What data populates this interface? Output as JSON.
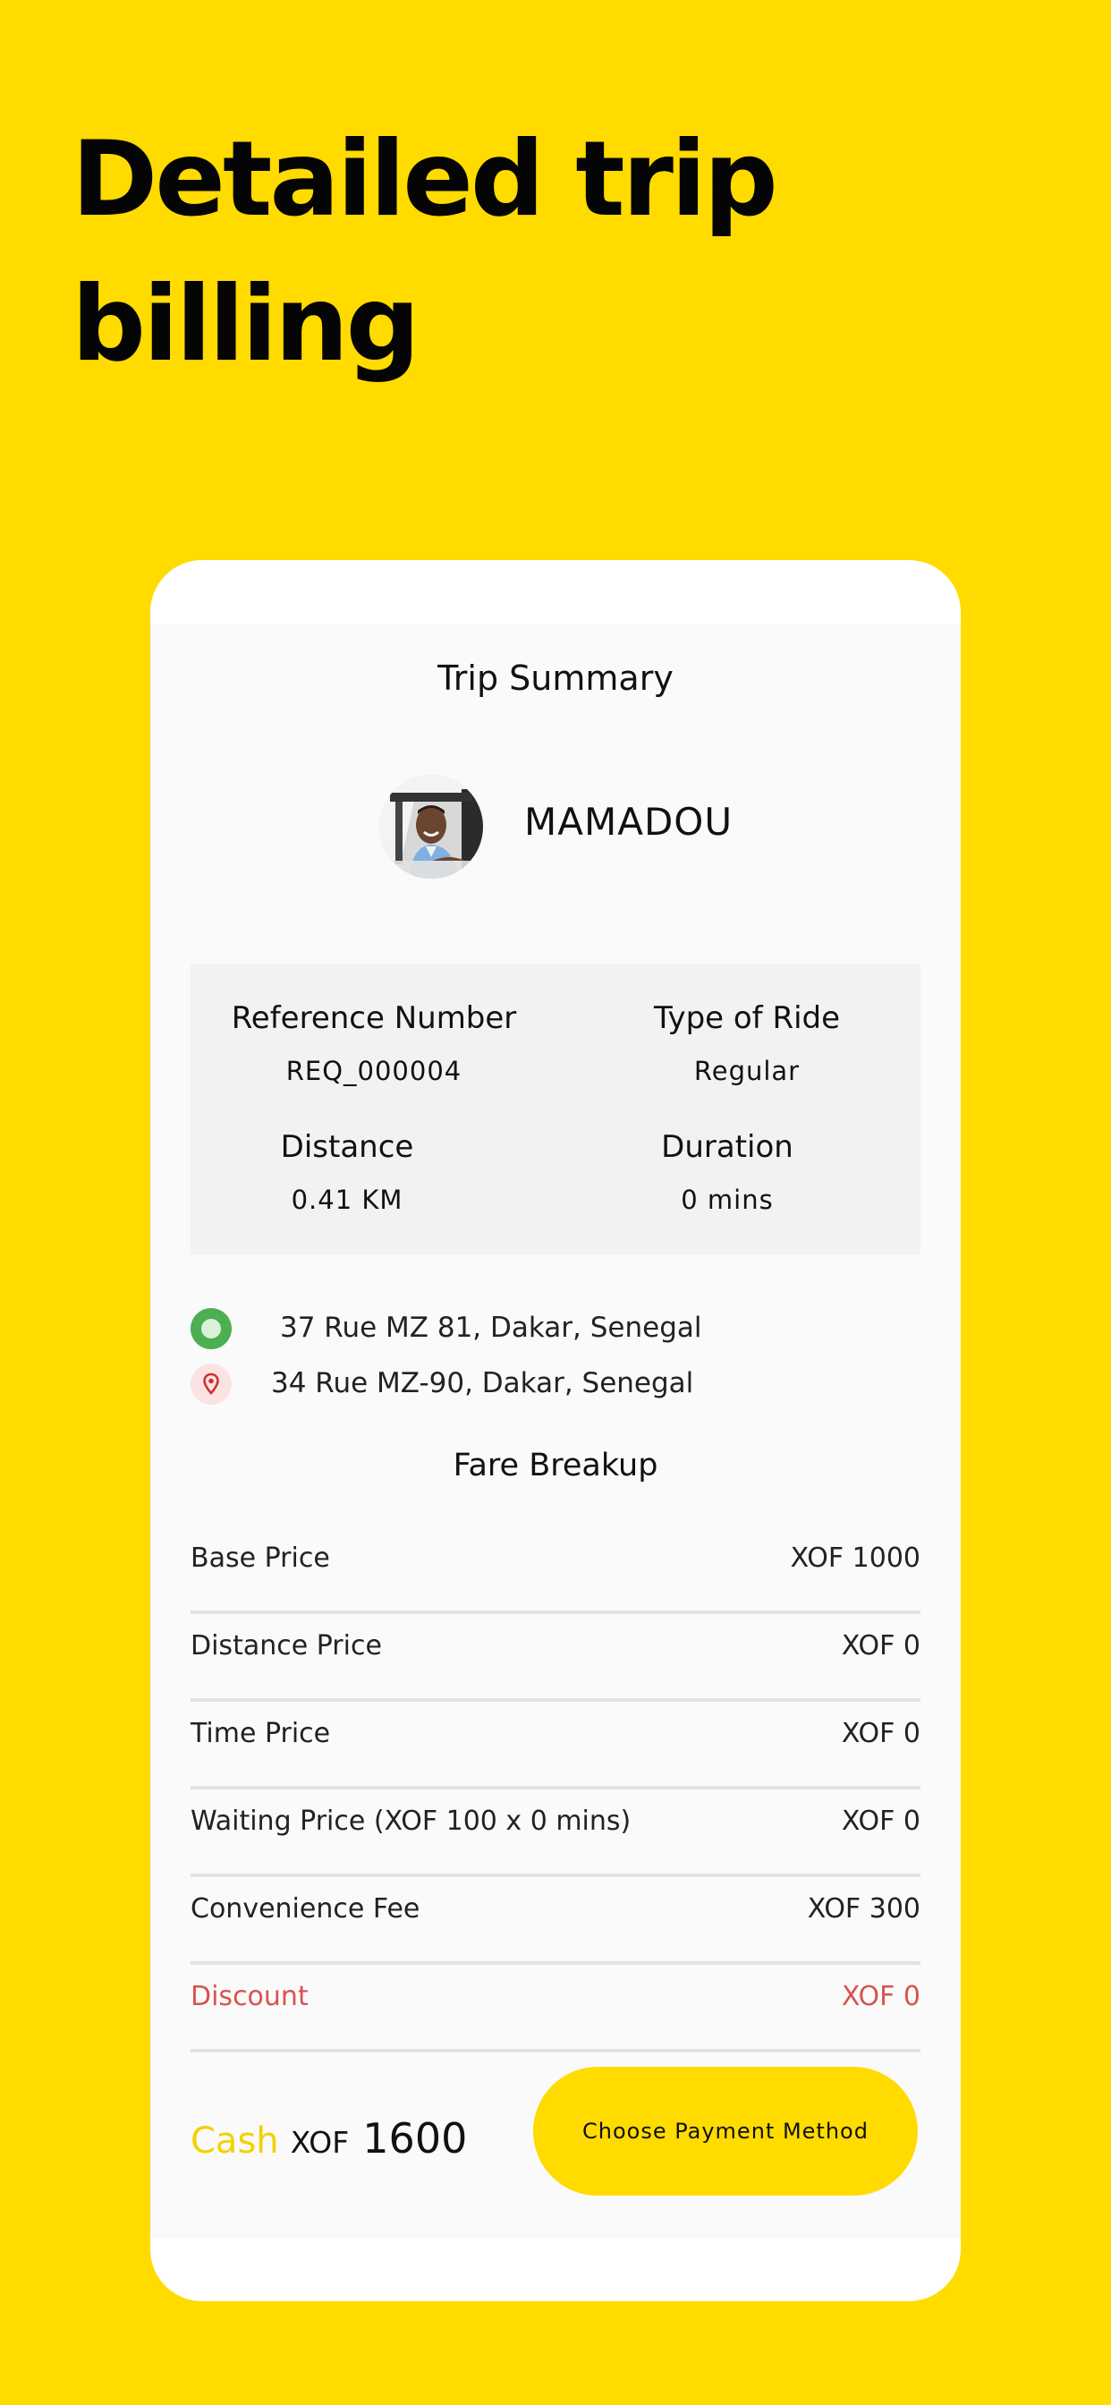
{
  "headline": "Detailed trip billing",
  "trip_summary": {
    "title": "Trip Summary",
    "driver_name": "MAMADOU"
  },
  "ride_info": {
    "reference_label": "Reference Number",
    "reference_value": "REQ_000004",
    "type_label": "Type of Ride",
    "type_value": "Regular",
    "distance_label": "Distance",
    "distance_value": "0.41 KM",
    "duration_label": "Duration",
    "duration_value": "0 mins"
  },
  "locations": {
    "pickup": "37 Rue MZ 81, Dakar, Senegal",
    "drop": "34 Rue MZ-90, Dakar, Senegal"
  },
  "fare": {
    "title": "Fare Breakup",
    "rows": [
      {
        "label": "Base Price",
        "amount": "XOF 1000"
      },
      {
        "label": "Distance Price",
        "amount": "XOF 0"
      },
      {
        "label": "Time Price",
        "amount": "XOF 0"
      },
      {
        "label": "Waiting Price (XOF 100 x 0 mins)",
        "amount": "XOF 0"
      },
      {
        "label": "Convenience Fee",
        "amount": "XOF 300"
      },
      {
        "label": "Discount",
        "amount": "XOF 0"
      }
    ]
  },
  "total": {
    "payment_type": "Cash",
    "currency": "XOF",
    "amount": "1600"
  },
  "pay_button_label": "Choose Payment Method",
  "colors": {
    "background": "#FFDB00",
    "accent": "#FFDB00",
    "discount": "#D9534F",
    "pickup": "#4CAF50",
    "drop": "#D32F2F"
  }
}
